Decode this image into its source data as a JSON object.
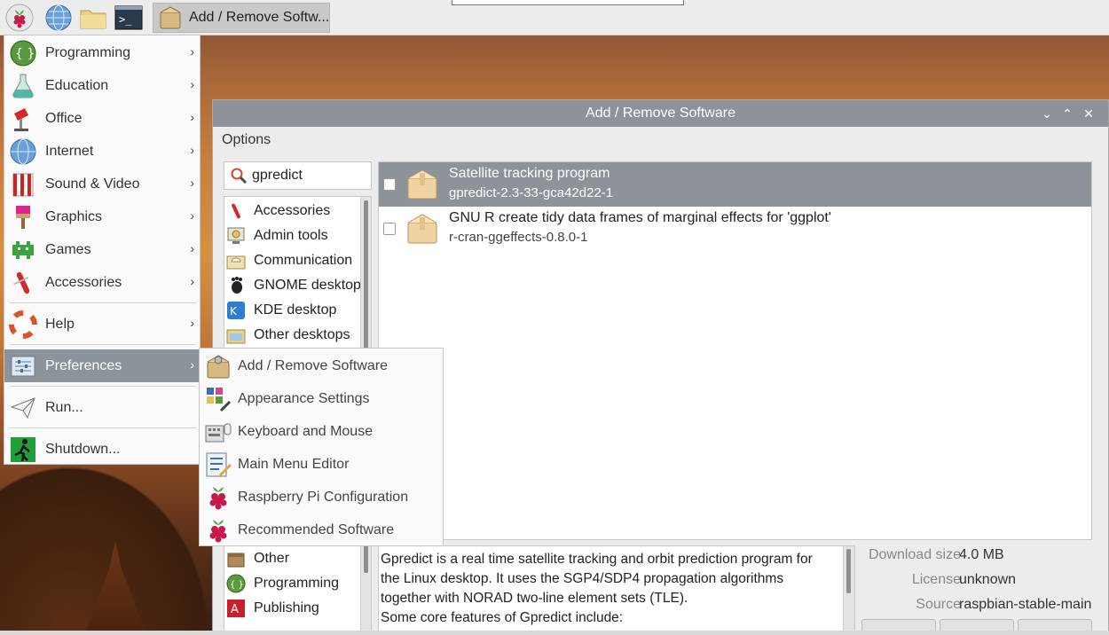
{
  "taskbar": {
    "active_task_label": "Add / Remove Softw...",
    "icons": [
      "raspberry-icon",
      "globe-icon",
      "folder-icon",
      "terminal-icon"
    ]
  },
  "main_menu": {
    "items": [
      {
        "label": "Programming",
        "icon": "programming-icon",
        "submenu": true
      },
      {
        "label": "Education",
        "icon": "education-icon",
        "submenu": true
      },
      {
        "label": "Office",
        "icon": "office-icon",
        "submenu": true
      },
      {
        "label": "Internet",
        "icon": "internet-icon",
        "submenu": true
      },
      {
        "label": "Sound & Video",
        "icon": "sound-video-icon",
        "submenu": true
      },
      {
        "label": "Graphics",
        "icon": "graphics-icon",
        "submenu": true
      },
      {
        "label": "Games",
        "icon": "games-icon",
        "submenu": true
      },
      {
        "label": "Accessories",
        "icon": "accessories-icon",
        "submenu": true
      },
      {
        "label": "Help",
        "icon": "help-icon",
        "submenu": true
      },
      {
        "label": "Preferences",
        "icon": "preferences-icon",
        "submenu": true,
        "active": true
      },
      {
        "label": "Run...",
        "icon": "run-icon",
        "submenu": false
      },
      {
        "label": "Shutdown...",
        "icon": "shutdown-icon",
        "submenu": false
      }
    ],
    "arrow": "›"
  },
  "preferences_submenu": {
    "items": [
      {
        "label": "Add / Remove Software",
        "icon": "package-icon"
      },
      {
        "label": "Appearance Settings",
        "icon": "appearance-icon"
      },
      {
        "label": "Keyboard and Mouse",
        "icon": "keyboard-mouse-icon"
      },
      {
        "label": "Main Menu Editor",
        "icon": "menu-editor-icon"
      },
      {
        "label": "Raspberry Pi Configuration",
        "icon": "raspberry-icon"
      },
      {
        "label": "Recommended Software",
        "icon": "raspberry-icon"
      }
    ]
  },
  "window": {
    "title": "Add / Remove Software",
    "controls": {
      "minimize": "⌄",
      "maximize": "⌃",
      "close": "✕"
    },
    "menu_options": "Options",
    "search_value": "gpredict",
    "categories_top": [
      {
        "label": "Accessories",
        "icon": "accessories-icon"
      },
      {
        "label": "Admin tools",
        "icon": "admin-icon"
      },
      {
        "label": "Communication",
        "icon": "communication-icon"
      },
      {
        "label": "GNOME desktop",
        "icon": "gnome-icon"
      },
      {
        "label": "KDE desktop",
        "icon": "kde-icon"
      },
      {
        "label": "Other desktops",
        "icon": "desktops-icon"
      }
    ],
    "categories_bottom": [
      {
        "label": "Other",
        "icon": "other-icon"
      },
      {
        "label": "Programming",
        "icon": "programming-icon"
      },
      {
        "label": "Publishing",
        "icon": "publishing-icon"
      }
    ],
    "packages": [
      {
        "name": "Satellite tracking program",
        "version": "gpredict-2.3-33-gca42d22-1",
        "selected": true
      },
      {
        "name": "GNU R create tidy data frames of marginal effects for 'ggplot'",
        "version": "r-cran-ggeffects-0.8.0-1",
        "selected": false
      }
    ],
    "description_lines": [
      "Gpredict is a real time satellite tracking and orbit prediction program for",
      "the Linux desktop. It uses the SGP4/SDP4 propagation algorithms",
      "together with NORAD two-line element sets (TLE).",
      "Some core features of Gpredict include:"
    ],
    "info": {
      "download_size_label": "Download size",
      "download_size_value": "4.0 MB",
      "license_label": "License",
      "license_value": "unknown",
      "source_label": "Source",
      "source_value": "raspbian-stable-main"
    }
  },
  "colors": {
    "selection": "#8d9398",
    "menu_bg": "#fafafa",
    "taskbar_bg": "#ececec"
  }
}
